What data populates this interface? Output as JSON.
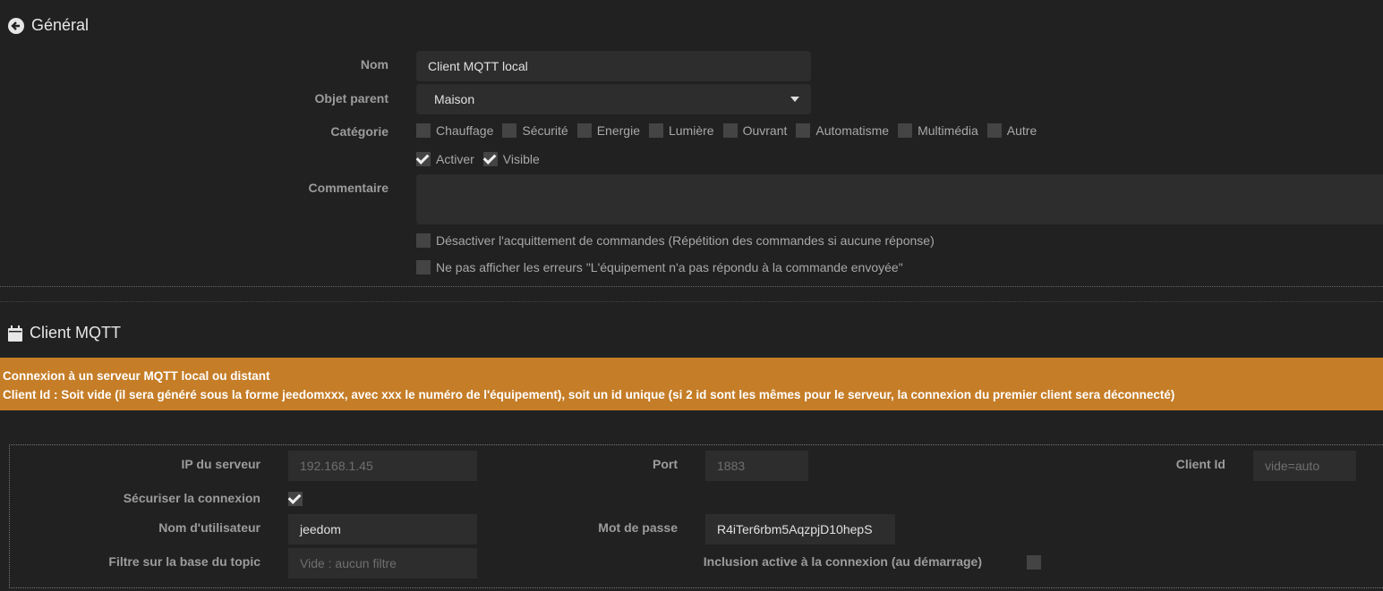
{
  "general": {
    "title": "Général",
    "nom_label": "Nom",
    "nom_value": "Client MQTT local",
    "parent_label": "Objet parent",
    "parent_value": "Maison",
    "categorie_label": "Catégorie",
    "categories": [
      "Chauffage",
      "Sécurité",
      "Energie",
      "Lumière",
      "Ouvrant",
      "Automatisme",
      "Multimédia",
      "Autre"
    ],
    "activer": "Activer",
    "visible": "Visible",
    "commentaire_label": "Commentaire",
    "disable_ack": "Désactiver l'acquittement de commandes (Répétition des commandes si aucune réponse)",
    "hide_errors": "Ne pas afficher les erreurs \"L'équipement n'a pas répondu à la commande envoyée\""
  },
  "mqtt": {
    "title": "Client MQTT",
    "alert_line1": "Connexion à un serveur MQTT local ou distant",
    "alert_line2": "Client Id : Soit vide (il sera généré sous la forme jeedomxxx, avec xxx le numéro de l'équipement), soit un id unique (si 2 id sont les mêmes pour le serveur, la connexion du premier client sera déconnecté)",
    "ip_label": "IP du serveur",
    "ip_placeholder": "192.168.1.45",
    "port_label": "Port",
    "port_placeholder": "1883",
    "clientid_label": "Client Id",
    "clientid_placeholder": "vide=auto",
    "secure_label": "Sécuriser la connexion",
    "user_label": "Nom d'utilisateur",
    "user_value": "jeedom",
    "pass_label": "Mot de passe",
    "pass_value": "R4iTer6rbm5AqzpjD10hepS",
    "topic_label": "Filtre sur la base du topic",
    "topic_placeholder": "Vide : aucun filtre",
    "inclusion_label": "Inclusion active à la connexion (au démarrage)"
  },
  "colors": {
    "alert": "#c57d27",
    "bg": "#212121"
  }
}
